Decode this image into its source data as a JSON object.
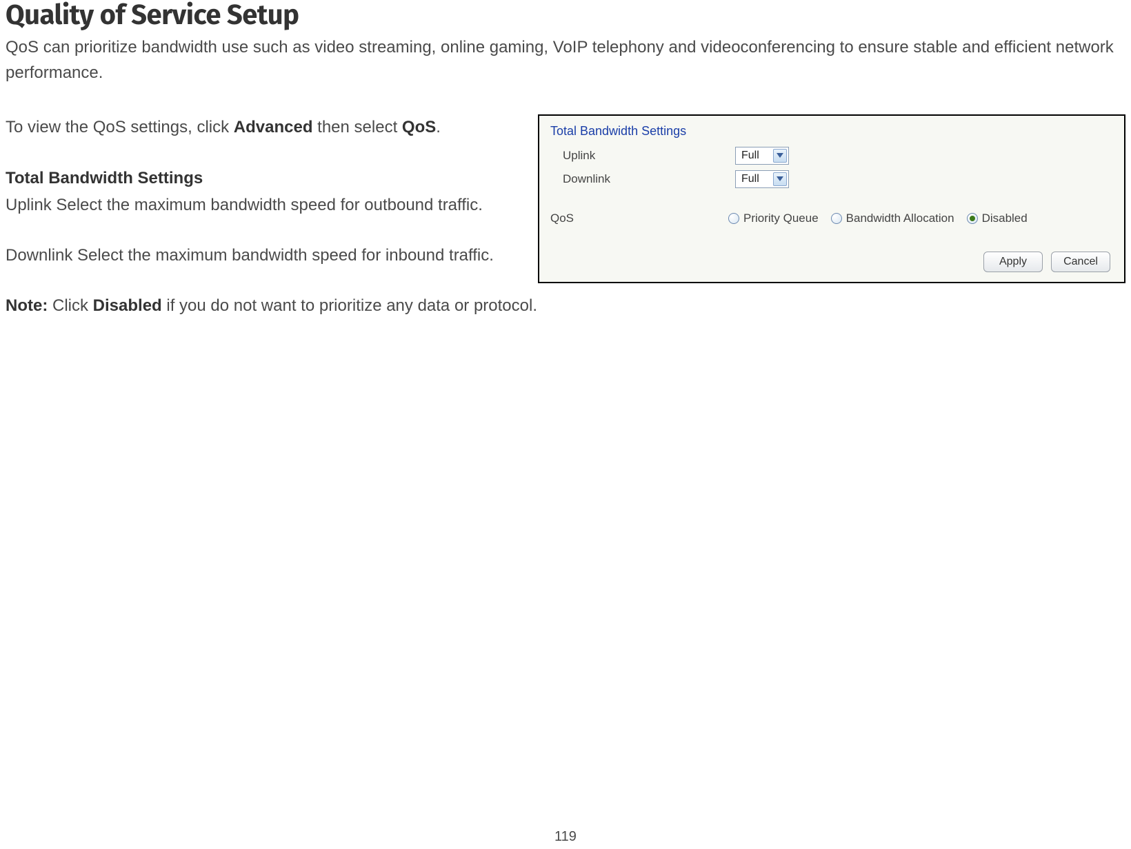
{
  "page": {
    "title": "Quality of Service Setup",
    "intro": "QoS can prioritize bandwidth use such as video streaming, online gaming, VoIP telephony and videoconferencing to ensure stable and efficient network performance.",
    "number": "119"
  },
  "left": {
    "view_prefix": "To view the QoS settings, click ",
    "view_bold1": "Advanced",
    "view_middle": " then select ",
    "view_bold2": "QoS",
    "view_suffix": ".",
    "subhead": "Total Bandwidth Settings",
    "uplink": "Uplink Select the maximum bandwidth speed for outbound traffic.",
    "downlink": "Downlink Select the maximum bandwidth speed for inbound traffic.",
    "note_label": "Note:",
    "note_prefix": " Click ",
    "note_bold": "Disabled",
    "note_suffix": " if you do not want to prioritize any data or protocol."
  },
  "shot": {
    "section_title": "Total Bandwidth Settings",
    "uplink_label": "Uplink",
    "uplink_value": "Full",
    "downlink_label": "Downlink",
    "downlink_value": "Full",
    "qos_label": "QoS",
    "options": {
      "priority": "Priority Queue",
      "bandwidth": "Bandwidth Allocation",
      "disabled": "Disabled"
    },
    "selected": "disabled",
    "apply": "Apply",
    "cancel": "Cancel"
  }
}
